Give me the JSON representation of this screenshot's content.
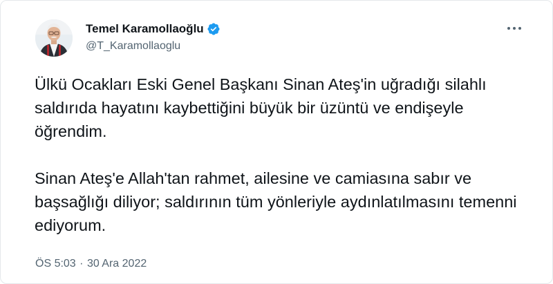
{
  "author": {
    "display_name": "Temel Karamollaoğlu",
    "handle": "@T_Karamollaoglu",
    "avatar_icon": "profile-photo",
    "verified_icon": "verified-badge-icon",
    "verified_color": "#1d9bf0"
  },
  "actions": {
    "more_icon": "more-options-icon"
  },
  "tweet": {
    "text": "Ülkü Ocakları Eski Genel Başkanı Sinan Ateş'in uğradığı silahlı saldırıda hayatını kaybettiğini büyük bir üzüntü ve endişeyle öğrendim.\n\nSinan Ateş'e Allah'tan rahmet, ailesine ve camiasına sabır ve başsağlığı diliyor; saldırının tüm yönleriyle aydınlatılmasını temenni ediyorum.",
    "time": "ÖS 5:03",
    "separator": "·",
    "date": "30 Ara 2022"
  },
  "colors": {
    "text_primary": "#0f1419",
    "text_secondary": "#536471",
    "border": "#e4e8eb"
  }
}
